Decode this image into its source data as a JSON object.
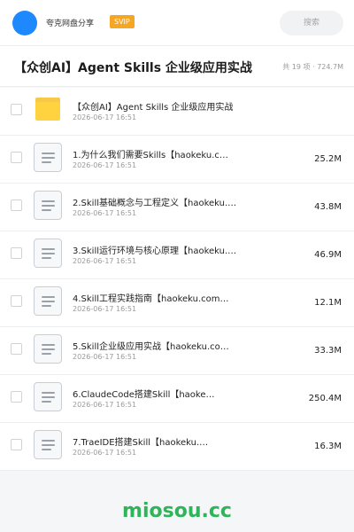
{
  "header": {
    "app_name": "夸克网盘分享",
    "badge": "SVIP",
    "search_placeholder": "搜索"
  },
  "folder": {
    "title": "【众创AI】Agent Skills 企业级应用实战",
    "summary": "共 19 项 · 724.7M"
  },
  "items": [
    {
      "type": "folder",
      "name": "【众创AI】Agent Skills 企业级应用实战",
      "date": "2026-06-17 16:51",
      "size": ""
    },
    {
      "type": "file",
      "name": "1.为什么我们需要Skills【haokeku.c…",
      "date": "2026-06-17 16:51",
      "size": "25.2M"
    },
    {
      "type": "file",
      "name": "2.Skill基础概念与工程定义【haokeku.…",
      "date": "2026-06-17 16:51",
      "size": "43.8M"
    },
    {
      "type": "file",
      "name": "3.Skill运行环境与核心原理【haokeku.…",
      "date": "2026-06-17 16:51",
      "size": "46.9M"
    },
    {
      "type": "file",
      "name": "4.Skill工程实践指南【haokeku.com…",
      "date": "2026-06-17 16:51",
      "size": "12.1M"
    },
    {
      "type": "file",
      "name": "5.Skill企业级应用实战【haokeku.co…",
      "date": "2026-06-17 16:51",
      "size": "33.3M"
    },
    {
      "type": "file",
      "name": "6.ClaudeCode搭建Skill【haoke…",
      "date": "2026-06-17 16:51",
      "size": "250.4M"
    },
    {
      "type": "file",
      "name": "7.TraeIDE搭建Skill【haokeku.…",
      "date": "2026-06-17 16:51",
      "size": "16.3M"
    }
  ],
  "watermark": "miosou.cc",
  "colors": {
    "accent": "#1e88ff",
    "badge": "#f5a623",
    "folder": "#ffd23f",
    "watermark": "#2fb45a"
  }
}
